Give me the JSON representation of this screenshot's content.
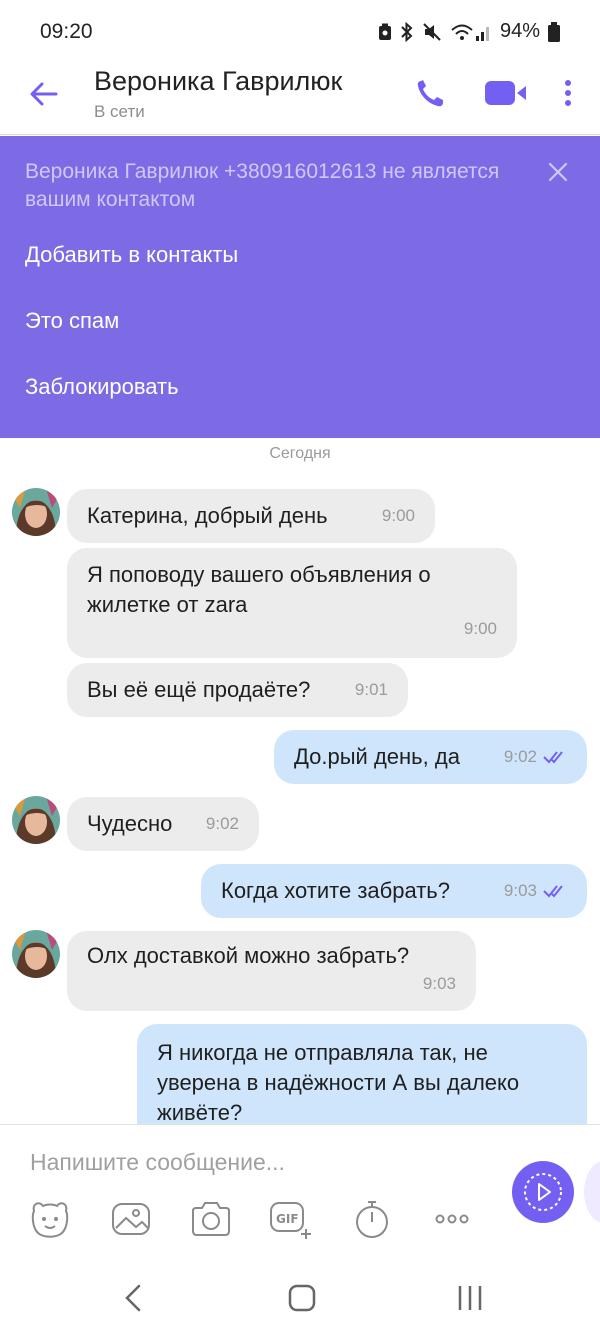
{
  "status_bar": {
    "time": "09:20",
    "battery": "94%"
  },
  "header": {
    "contact_name": "Вероника Гаврилюк",
    "presence": "В сети"
  },
  "banner": {
    "notice": "Вероника Гаврилюк +380916012613 не является вашим контактом",
    "actions": [
      "Добавить в контакты",
      "Это спам",
      "Заблокировать"
    ]
  },
  "chat": {
    "date_divider": "Сегодня",
    "messages": [
      {
        "dir": "in",
        "text": "Катерина, добрый день",
        "time": "9:00"
      },
      {
        "dir": "in",
        "text": "Я поповоду вашего объявления о жилетке от zara",
        "time": "9:00"
      },
      {
        "dir": "in",
        "text": "Вы её ещё продаёте?",
        "time": "9:01"
      },
      {
        "dir": "out",
        "text": "До.рый день, да",
        "time": "9:02"
      },
      {
        "dir": "in",
        "text": "Чудесно",
        "time": "9:02"
      },
      {
        "dir": "out",
        "text": "Когда хотите забрать?",
        "time": "9:03"
      },
      {
        "dir": "in",
        "text": "Олх доставкой можно забрать?",
        "time": "9:03"
      },
      {
        "dir": "out",
        "text": "Я никогда не отправляла так, не уверена в надёжности А вы далеко живёте?",
        "time": ""
      }
    ]
  },
  "composer": {
    "placeholder": "Напишите сообщение..."
  },
  "colors": {
    "accent": "#7360f2",
    "banner": "#7d6be6",
    "incoming_bubble": "#ececec",
    "outgoing_bubble": "#cfe5fb"
  },
  "icons": [
    "back-arrow-icon",
    "phone-icon",
    "video-camera-icon",
    "more-vertical-icon",
    "close-icon",
    "sticker-icon",
    "gallery-icon",
    "camera-icon",
    "gif-icon",
    "timer-icon",
    "more-horizontal-icon",
    "send-icon",
    "nav-back-icon",
    "nav-home-icon",
    "nav-recents-icon"
  ]
}
